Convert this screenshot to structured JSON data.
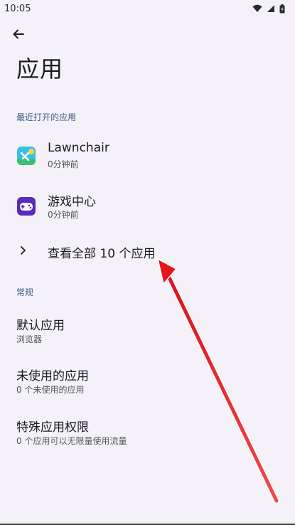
{
  "status_bar": {
    "time": "10:05",
    "icons": [
      "wifi-icon",
      "cellular-signal-icon",
      "battery-icon"
    ]
  },
  "header": {
    "back_icon": "back-arrow-icon",
    "title": "应用"
  },
  "recent": {
    "section_label": "最近打开的应用",
    "apps": [
      {
        "name": "Lawnchair",
        "time": "0分钟前",
        "icon": "lawnchair-icon"
      },
      {
        "name": "游戏中心",
        "time": "0分钟前",
        "icon": "game-center-icon"
      }
    ],
    "see_all_label": "查看全部 10 个应用"
  },
  "general": {
    "section_label": "常规",
    "items": [
      {
        "title": "默认应用",
        "subtitle": "浏览器"
      },
      {
        "title": "未使用的应用",
        "subtitle": "0 个未使用的应用"
      },
      {
        "title": "特殊应用权限",
        "subtitle": "0 个应用可以无限量使用流量"
      }
    ]
  },
  "colors": {
    "background": "#f4f2f8",
    "section_header": "#3d5a8a",
    "annotation_arrow": "#e8141b"
  }
}
